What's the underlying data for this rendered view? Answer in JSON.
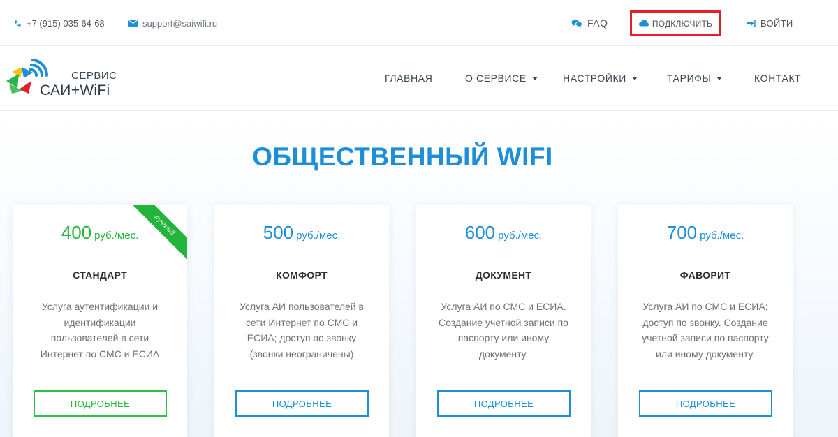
{
  "topbar": {
    "phone": "+7 (915) 035-64-68",
    "email": "support@saiwifi.ru",
    "faq": "FAQ",
    "connect": "ПОДКЛЮЧИТЬ",
    "login": "ВОЙТИ",
    "connect_highlight_color": "#e3202a"
  },
  "logo": {
    "top": "СЕРВИС",
    "bottom": "САИ+WiFi"
  },
  "nav": [
    {
      "label": "ГЛАВНАЯ",
      "dropdown": false
    },
    {
      "label": "О СЕРВИСЕ",
      "dropdown": true
    },
    {
      "label": "НАСТРОЙКИ",
      "dropdown": true
    },
    {
      "label": "ТАРИФЫ",
      "dropdown": true
    },
    {
      "label": "КОНТАКТ",
      "dropdown": false
    }
  ],
  "section": {
    "title": "ОБЩЕСТВЕННЫЙ WIFI"
  },
  "colors": {
    "accent": "#1e8fd6",
    "featured": "#27b53f"
  },
  "plans": [
    {
      "price": "400",
      "unit": "руб./мес.",
      "name": "СТАНДАРТ",
      "description": "Услуга аутентификации и идентификации пользователей в сети Интернет по СМС и ЕСИА",
      "button": "ПОДРОБНЕЕ",
      "badge": "лучший"
    },
    {
      "price": "500",
      "unit": "руб./мес.",
      "name": "КОМФОРТ",
      "description": "Услуга АИ пользователей в сети Интернет по СМС и ЕСИА; доступ по звонку (звонки неограничены)",
      "button": "ПОДРОБНЕЕ"
    },
    {
      "price": "600",
      "unit": "руб./мес.",
      "name": "ДОКУМЕНТ",
      "description": "Услуга АИ по СМС и ЕСИА. Создание учетной записи по паспорту или иному документу.",
      "button": "ПОДРОБНЕЕ"
    },
    {
      "price": "700",
      "unit": "руб./мес.",
      "name": "ФАВОРИТ",
      "description": "Услуга АИ по СМС и ЕСИА; доступ по звонку. Создание учетной записи по паспорту или иному документу.",
      "button": "ПОДРОБНЕЕ"
    }
  ]
}
